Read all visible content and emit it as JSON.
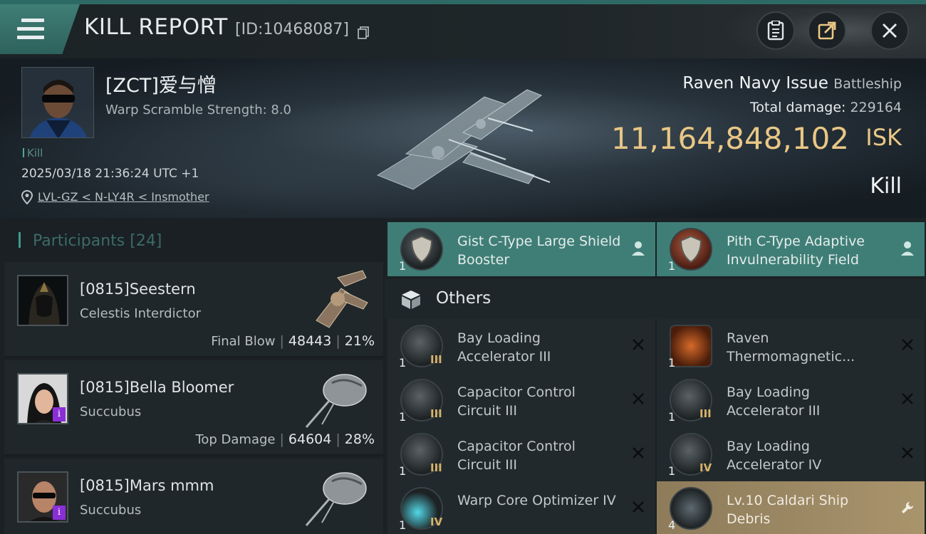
{
  "header": {
    "title": "KILL REPORT",
    "report_id": "[ID:10468087]",
    "menu_icon": "hamburger-menu-icon",
    "buttons": [
      "clipboard-icon",
      "share-icon",
      "close-icon"
    ]
  },
  "victim": {
    "name": "[ZCT]爱与憎",
    "warp_scramble": "Warp Scramble Strength: 8.0",
    "kill_tag": "Kill",
    "timestamp": "2025/03/18 21:36:24 UTC +1",
    "location": "LVL-GZ < N-LY4R < Insmother",
    "ship_name": "Raven Navy Issue",
    "ship_class": "Battleship",
    "damage_label": "Total damage:",
    "damage_value": "229164",
    "isk_value": "11,164,848,102",
    "isk_unit": "ISK",
    "result": "Kill"
  },
  "participants": {
    "label": "Participants",
    "count": "[24]",
    "rows": [
      {
        "name": "[0815]Seestern",
        "ship": "Celestis Interdictor",
        "stat_label": "Final Blow",
        "damage": "48443",
        "percent": "21%",
        "badge": ""
      },
      {
        "name": "[0815]Bella Bloomer",
        "ship": "Succubus",
        "stat_label": "Top Damage",
        "damage": "64604",
        "percent": "28%",
        "badge": "i"
      },
      {
        "name": "[0815]Mars mmm",
        "ship": "Succubus",
        "stat_label": "",
        "damage": "",
        "percent": "",
        "badge": "i"
      }
    ]
  },
  "items": {
    "fitted": [
      {
        "name": "Gist C-Type Large Shield Booster",
        "qty": "1"
      },
      {
        "name": "Pith C-Type Adaptive Invulnerability Field",
        "qty": "1"
      }
    ],
    "others_label": "Others",
    "others": [
      {
        "name": "Bay Loading Accelerator III",
        "qty": "1",
        "tier": "III"
      },
      {
        "name": "Raven Thermomagnetic...",
        "qty": "1",
        "tier": ""
      },
      {
        "name": "Capacitor Control Circuit III",
        "qty": "1",
        "tier": "III"
      },
      {
        "name": "Bay Loading Accelerator III",
        "qty": "1",
        "tier": "III"
      },
      {
        "name": "Capacitor Control Circuit III",
        "qty": "1",
        "tier": "III"
      },
      {
        "name": "Bay Loading Accelerator IV",
        "qty": "1",
        "tier": "IV"
      },
      {
        "name": "Warp Core Optimizer IV",
        "qty": "1",
        "tier": "IV"
      },
      {
        "name": "Lv.10 Caldari Ship Debris",
        "qty": "4",
        "tier": ""
      }
    ]
  },
  "colors": {
    "accent_teal": "#3f7e77",
    "isk_gold": "#e9c785",
    "debris_gold": "#a9946c"
  }
}
